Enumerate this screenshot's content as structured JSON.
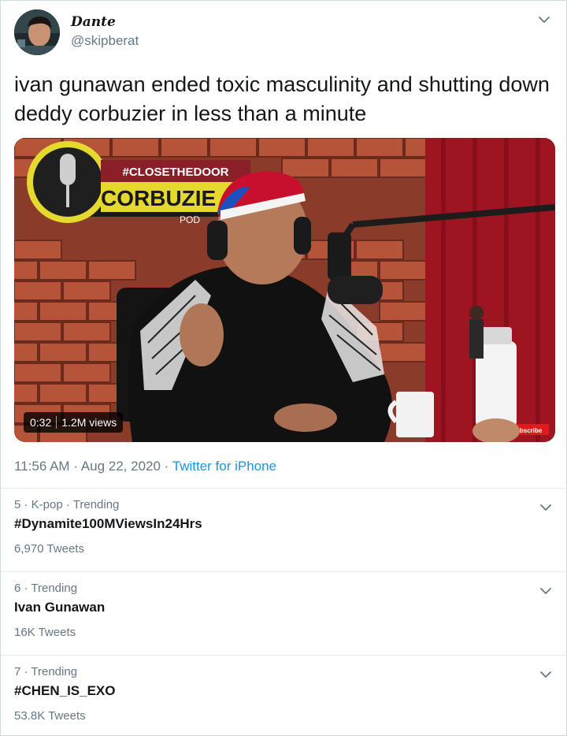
{
  "tweet": {
    "display_name": "Dante",
    "handle": "@skipberat",
    "text": "ivan gunawan ended toxic masculinity and shutting down deddy corbuzier in less than a minute",
    "media": {
      "type": "video",
      "duration": "0:32",
      "views": "1.2M views",
      "sign_hashtag": "#CLOSETHEDOOR",
      "sign_name": "CORBUZIE",
      "sign_sub": "POD",
      "subscribe_label": "Subscribe"
    },
    "time": "11:56 AM",
    "date": "Aug 22, 2020",
    "separator": "·",
    "source": "Twitter for iPhone"
  },
  "trends": [
    {
      "context": "5 · K-pop · Trending",
      "name": "#Dynamite100MViewsIn24Hrs",
      "count": "6,970 Tweets"
    },
    {
      "context": "6 · Trending",
      "name": "Ivan Gunawan",
      "count": "16K Tweets"
    },
    {
      "context": "7 · Trending",
      "name": "#CHEN_IS_EXO",
      "count": "53.8K Tweets"
    }
  ],
  "icons": {
    "caret": "chevron-down-icon",
    "avatar": "profile-photo"
  },
  "colors": {
    "link": "#1b95e0",
    "secondary_text": "#657786",
    "divider": "#e6ecf0"
  }
}
